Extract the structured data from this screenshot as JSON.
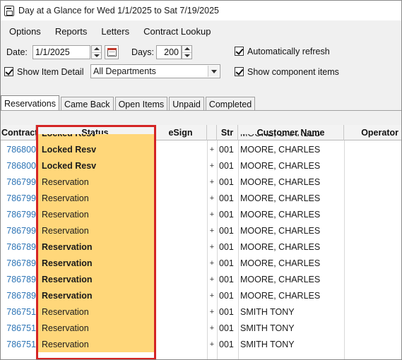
{
  "window": {
    "title": "Day at a Glance for Wed 1/1/2025 to Sat 7/19/2025"
  },
  "menu": [
    "Options",
    "Reports",
    "Letters",
    "Contract Lookup"
  ],
  "controls": {
    "date_label": "Date:",
    "date_value": "1/1/2025",
    "days_label": "Days:",
    "days_value": "200",
    "auto_refresh_label": "Automatically refresh",
    "auto_refresh_checked": true,
    "show_item_detail_label": "Show Item Detail",
    "show_item_detail_checked": true,
    "department_selected": "All Departments",
    "show_component_label": "Show component items",
    "show_component_checked": true
  },
  "tabs": [
    "Reservations",
    "Came Back",
    "Open Items",
    "Unpaid",
    "Completed"
  ],
  "active_tab": "Reservations",
  "grid": {
    "columns": [
      "Contract",
      "Status",
      "eSign",
      "Str",
      "Customer Name",
      "Operator"
    ],
    "partial_top_row": {
      "contract": "",
      "status": "Locked Resv",
      "str": "",
      "customer": "MOORE, CHARLES"
    },
    "rows": [
      {
        "contract": "786800",
        "status": "Locked Resv",
        "bold": true,
        "plus": "+",
        "str": "001",
        "customer": "MOORE, CHARLES"
      },
      {
        "contract": "786800",
        "status": "Locked Resv",
        "bold": true,
        "plus": "+",
        "str": "001",
        "customer": "MOORE, CHARLES"
      },
      {
        "contract": "786799",
        "status": "Reservation",
        "bold": false,
        "plus": "+",
        "str": "001",
        "customer": "MOORE, CHARLES"
      },
      {
        "contract": "786799",
        "status": "Reservation",
        "bold": false,
        "plus": "+",
        "str": "001",
        "customer": "MOORE, CHARLES"
      },
      {
        "contract": "786799",
        "status": "Reservation",
        "bold": false,
        "plus": "+",
        "str": "001",
        "customer": "MOORE, CHARLES"
      },
      {
        "contract": "786799",
        "status": "Reservation",
        "bold": false,
        "plus": "+",
        "str": "001",
        "customer": "MOORE, CHARLES"
      },
      {
        "contract": "786789",
        "status": "Reservation",
        "bold": true,
        "plus": "+",
        "str": "001",
        "customer": "MOORE, CHARLES"
      },
      {
        "contract": "786789",
        "status": "Reservation",
        "bold": true,
        "plus": "+",
        "str": "001",
        "customer": "MOORE, CHARLES"
      },
      {
        "contract": "786789",
        "status": "Reservation",
        "bold": true,
        "plus": "+",
        "str": "001",
        "customer": "MOORE, CHARLES"
      },
      {
        "contract": "786789",
        "status": "Reservation",
        "bold": true,
        "plus": "+",
        "str": "001",
        "customer": "MOORE, CHARLES"
      },
      {
        "contract": "786751",
        "status": "Reservation",
        "bold": false,
        "plus": "+",
        "str": "001",
        "customer": "SMITH TONY"
      },
      {
        "contract": "786751",
        "status": "Reservation",
        "bold": false,
        "plus": "+",
        "str": "001",
        "customer": "SMITH TONY"
      },
      {
        "contract": "786751",
        "status": "Reservation",
        "bold": false,
        "plus": "+",
        "str": "001",
        "customer": "SMITH TONY"
      }
    ]
  },
  "colors": {
    "status_fill": "#ffd77a",
    "highlight_border": "#d42424",
    "contract_link": "#2e75b6"
  }
}
